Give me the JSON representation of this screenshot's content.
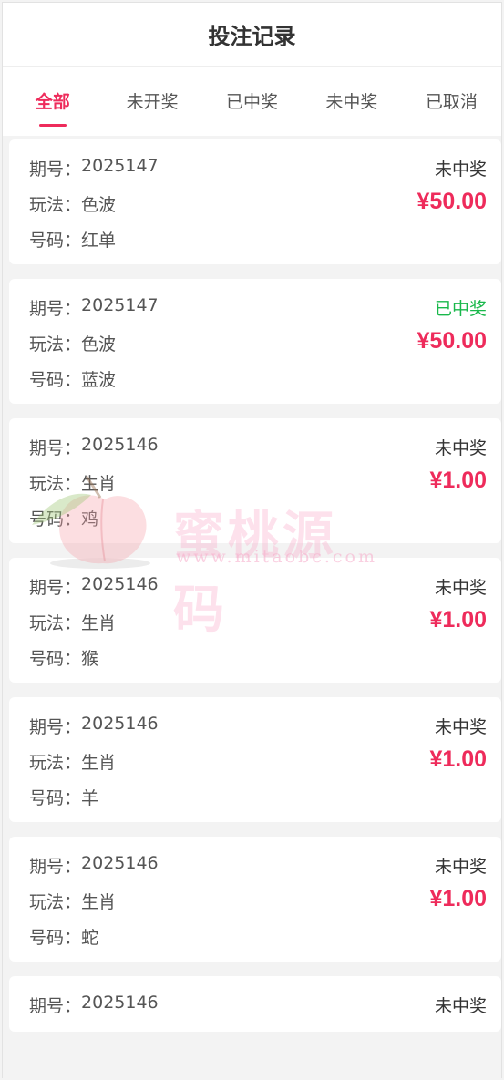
{
  "header": {
    "title": "投注记录"
  },
  "tabs": [
    {
      "label": "全部"
    },
    {
      "label": "未开奖"
    },
    {
      "label": "已中奖"
    },
    {
      "label": "未中奖"
    },
    {
      "label": "已取消"
    }
  ],
  "labels": {
    "issue": "期号：",
    "play": "玩法：",
    "number": "号码："
  },
  "records": [
    {
      "issue": "2025147",
      "play": "色波",
      "number": "红单",
      "status": "未中奖",
      "amount": "¥50.00"
    },
    {
      "issue": "2025147",
      "play": "色波",
      "number": "蓝波",
      "status": "已中奖",
      "amount": "¥50.00"
    },
    {
      "issue": "2025146",
      "play": "生肖",
      "number": "鸡",
      "status": "未中奖",
      "amount": "¥1.00"
    },
    {
      "issue": "2025146",
      "play": "生肖",
      "number": "猴",
      "status": "未中奖",
      "amount": "¥1.00"
    },
    {
      "issue": "2025146",
      "play": "生肖",
      "number": "羊",
      "status": "未中奖",
      "amount": "¥1.00"
    },
    {
      "issue": "2025146",
      "play": "生肖",
      "number": "蛇",
      "status": "未中奖",
      "amount": "¥1.00"
    },
    {
      "issue": "2025146",
      "status": "未中奖"
    }
  ],
  "watermark": {
    "brand": "蜜桃源码",
    "url": "www.mitaobc.com",
    "icon": "peach-icon"
  },
  "colors": {
    "accent": "#ee2b5b",
    "won": "#19b84b"
  }
}
